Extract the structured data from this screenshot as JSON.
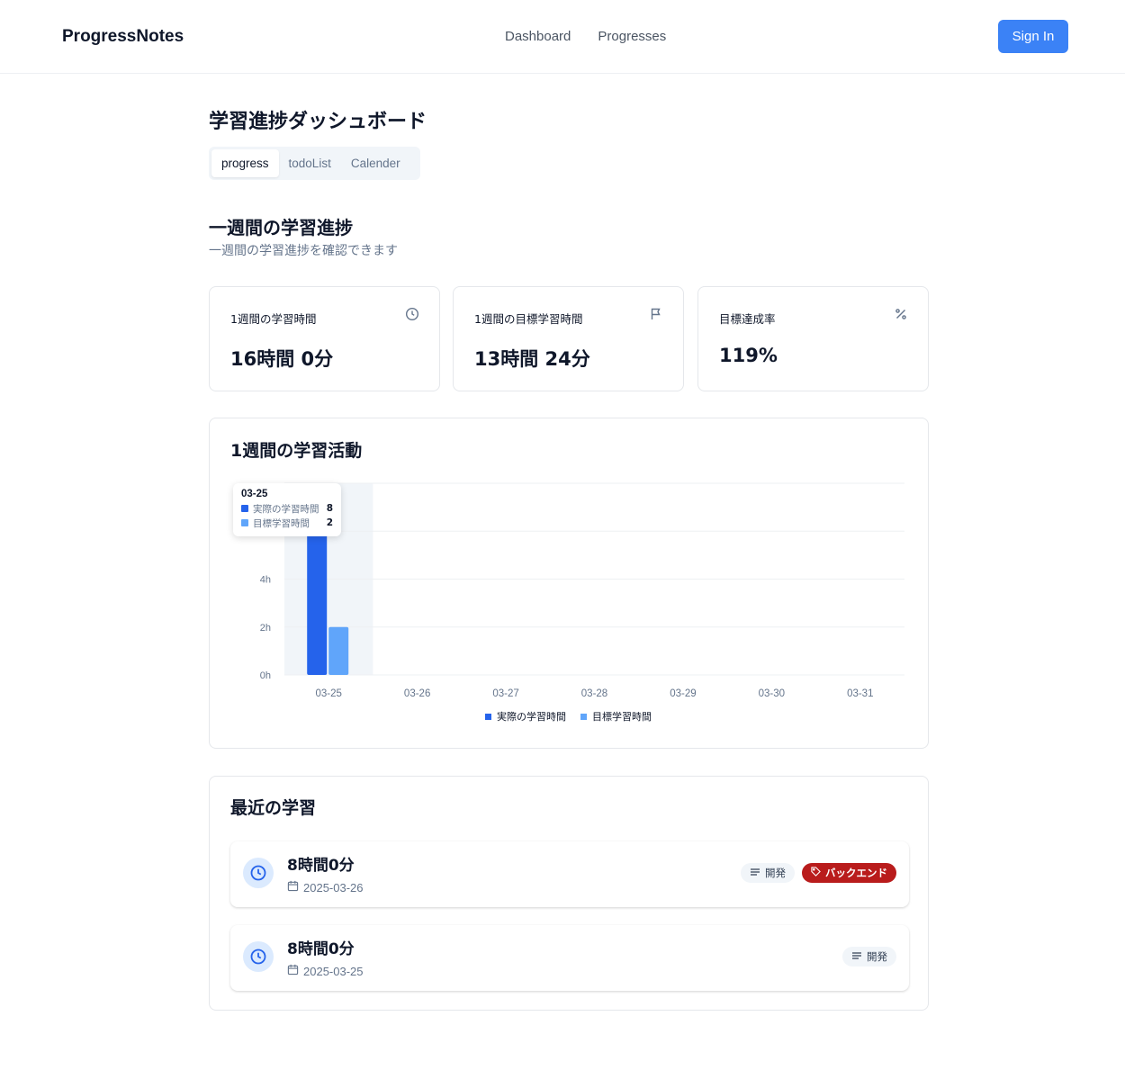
{
  "header": {
    "brand": "ProgressNotes",
    "nav": [
      "Dashboard",
      "Progresses"
    ],
    "signin_label": "Sign In"
  },
  "page": {
    "title": "学習進捗ダッシュボード",
    "tabs": [
      "progress",
      "todoList",
      "Calender"
    ],
    "active_tab": "progress"
  },
  "week": {
    "title": "一週間の学習進捗",
    "subtitle": "一週間の学習進捗を確認できます"
  },
  "stats": [
    {
      "label": "1週間の学習時間",
      "value": "16時間 0分",
      "icon": "clock-icon"
    },
    {
      "label": "1週間の目標学習時間",
      "value": "13時間 24分",
      "icon": "flag-icon"
    },
    {
      "label": "目標達成率",
      "value": "119%",
      "icon": "percent-icon"
    }
  ],
  "chart_card": {
    "title": "1週間の学習活動",
    "tooltip": {
      "date": "03-25",
      "rows": [
        {
          "label": "実際の学習時間",
          "value": "8"
        },
        {
          "label": "目標学習時間",
          "value": "2"
        }
      ]
    }
  },
  "chart_data": {
    "type": "bar",
    "categories": [
      "03-25",
      "03-26",
      "03-27",
      "03-28",
      "03-29",
      "03-30",
      "03-31"
    ],
    "series": [
      {
        "name": "実際の学習時間",
        "values": [
          8,
          0,
          0,
          0,
          0,
          0,
          0
        ],
        "color": "#2563eb"
      },
      {
        "name": "目標学習時間",
        "values": [
          2,
          0,
          0,
          0,
          0,
          0,
          0
        ],
        "color": "#60a5fa"
      }
    ],
    "yticks": [
      "0h",
      "2h",
      "4h"
    ],
    "ylim": [
      0,
      8
    ],
    "legend": "bottom",
    "highlight_category": "03-25",
    "grid": true
  },
  "recent": {
    "title": "最近の学習",
    "entries": [
      {
        "duration": "8時間0分",
        "date": "2025-03-26",
        "category": "開発",
        "tag": "バックエンド"
      },
      {
        "duration": "8時間0分",
        "date": "2025-03-25",
        "category": "開発",
        "tag": ""
      }
    ]
  },
  "colors": {
    "accent": "#3b82f6",
    "tag_red": "#b91c1c",
    "series_actual": "#2563eb",
    "series_target": "#60a5fa"
  }
}
